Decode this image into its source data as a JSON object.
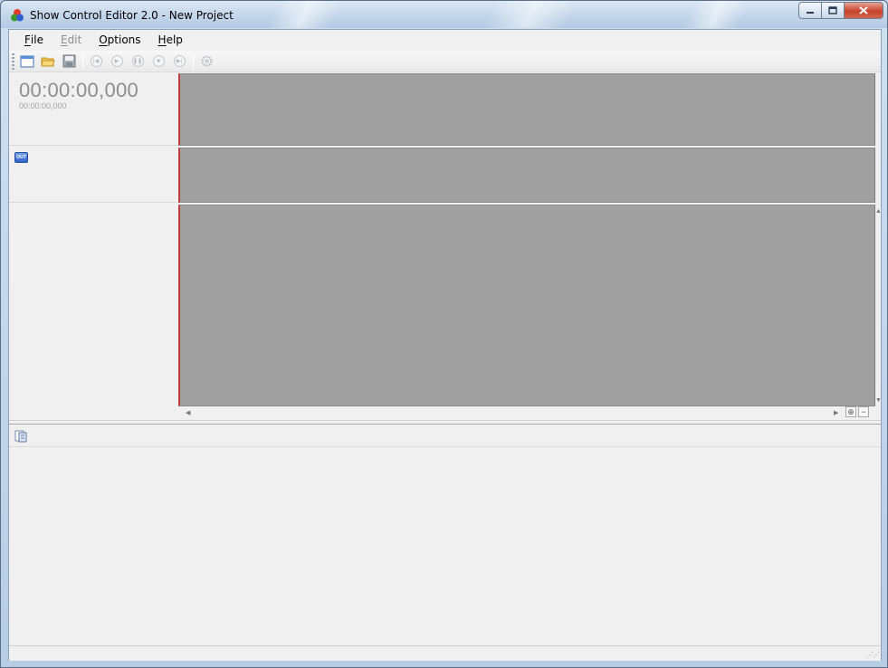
{
  "window": {
    "title": "Show Control Editor 2.0 - New Project",
    "app_icon": "rgb-circles-icon",
    "caption_buttons": {
      "minimize": "minimize-icon",
      "maximize": "maximize-icon",
      "close": "close-icon"
    }
  },
  "menu": {
    "items": [
      {
        "accel": "F",
        "rest": "ile",
        "enabled": true
      },
      {
        "accel": "E",
        "rest": "dit",
        "enabled": false
      },
      {
        "accel": "O",
        "rest": "ptions",
        "enabled": true
      },
      {
        "accel": "H",
        "rest": "elp",
        "enabled": true
      }
    ]
  },
  "toolbar": {
    "buttons": [
      {
        "name": "new-project-button",
        "icon": "new-window-icon",
        "enabled": true
      },
      {
        "name": "open-project-button",
        "icon": "folder-open-icon",
        "enabled": true
      },
      {
        "name": "save-project-button",
        "icon": "floppy-disk-icon",
        "enabled": true
      },
      {
        "name": "rewind-start-button",
        "icon": "skip-start-icon",
        "enabled": false
      },
      {
        "name": "play-button",
        "icon": "play-icon",
        "enabled": false
      },
      {
        "name": "pause-button",
        "icon": "pause-icon",
        "enabled": false
      },
      {
        "name": "stop-button",
        "icon": "stop-icon",
        "enabled": false
      },
      {
        "name": "skip-end-button",
        "icon": "skip-end-icon",
        "enabled": false
      },
      {
        "name": "settings-button",
        "icon": "gear-icon",
        "enabled": false
      }
    ]
  },
  "timecode": {
    "main": "00:00:00,000",
    "secondary": "00:00:00,000"
  },
  "tracks": {
    "output_badge": "OUT"
  },
  "colors": {
    "timeline_bg": "#a0a0a0",
    "playhead": "#c23b3b",
    "panel_bg": "#f0f0f0",
    "timecode_text": "#8e8e8e"
  }
}
